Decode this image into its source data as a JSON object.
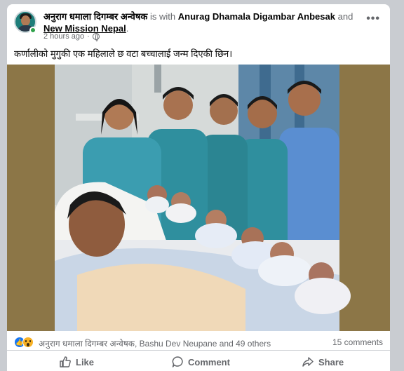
{
  "post": {
    "author": "अनुराग धमाला दिगम्बर अन्वेषक",
    "with_text": "is with",
    "tagged_1": "Anurag Dhamala Digambar Anbesak",
    "and_text": "and",
    "tagged_2": "New Mission Nepal",
    "period": ".",
    "timestamp": "2 hours ago",
    "dot": "·",
    "more_label": "•••",
    "text": "कर्णालीको मुगुकी  एक महिलाले छ वटा बच्चालाई जन्म दिएकी छिन।",
    "avatar_icon": "profile-avatar",
    "privacy_icon": "globe-icon"
  },
  "stats": {
    "reaction_icons": [
      "like-icon",
      "wow-icon"
    ],
    "reacted_by": "अनुराग धमाला दिगम्बर अन्वेषक, Bashu Dev Neupane and 49 others",
    "comments": "15 comments"
  },
  "actions": {
    "like": "Like",
    "comment": "Comment",
    "share": "Share"
  },
  "colors": {
    "brand_blue": "#1877f2",
    "text_primary": "#050505",
    "text_secondary": "#65676b",
    "scrubs": "#2f8f9e"
  }
}
